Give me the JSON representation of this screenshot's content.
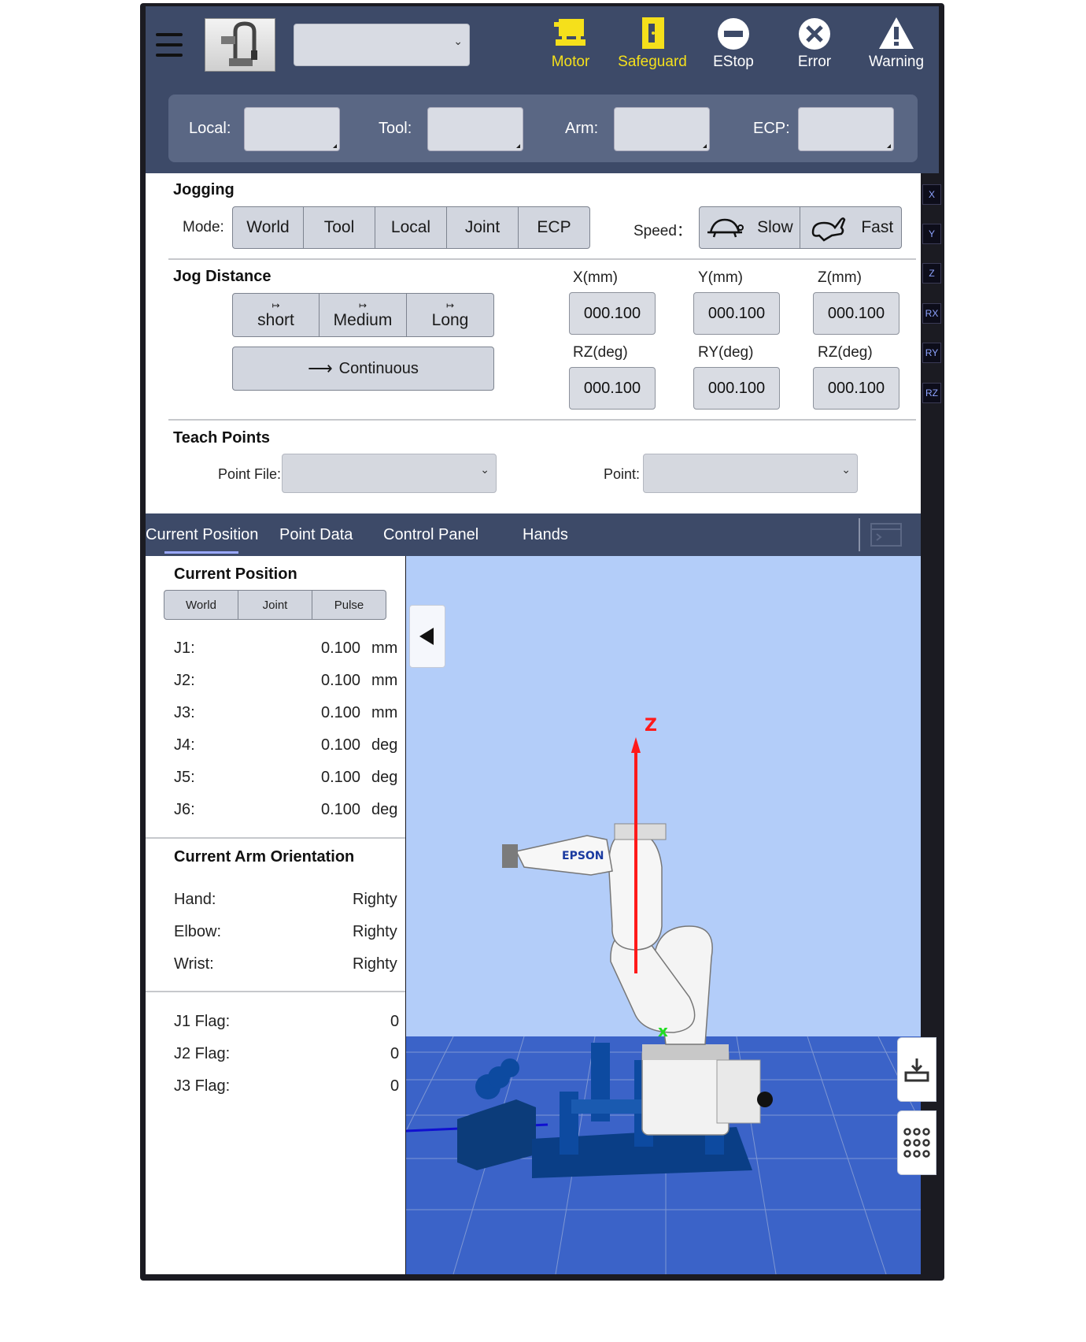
{
  "header": {
    "robot_select": {
      "value": ""
    },
    "status": [
      {
        "label": "Motor",
        "icon": "motor-icon",
        "color": "#f5e01b"
      },
      {
        "label": "Safeguard",
        "icon": "safeguard-icon",
        "color": "#f5e01b"
      },
      {
        "label": "EStop",
        "icon": "estop-icon",
        "color": "#ffffff"
      },
      {
        "label": "Error",
        "icon": "error-icon",
        "color": "#ffffff"
      },
      {
        "label": "Warning",
        "icon": "warning-icon",
        "color": "#ffffff"
      }
    ],
    "coords": {
      "local": {
        "label": "Local:",
        "value": ""
      },
      "tool": {
        "label": "Tool:",
        "value": ""
      },
      "arm": {
        "label": "Arm:",
        "value": ""
      },
      "ecp": {
        "label": "ECP:",
        "value": ""
      }
    }
  },
  "jogging": {
    "title": "Jogging",
    "mode_label": "Mode:",
    "modes": [
      "World",
      "Tool",
      "Local",
      "Joint",
      "ECP"
    ],
    "speed_label": "Speed：",
    "speeds": [
      {
        "label": "Slow",
        "icon": "turtle-icon"
      },
      {
        "label": "Fast",
        "icon": "rabbit-icon"
      }
    ]
  },
  "jog_distance": {
    "title": "Jog Distance",
    "steps": [
      "short",
      "Medium",
      "Long"
    ],
    "continuous": "Continuous",
    "fields": [
      {
        "label": "X(mm)",
        "value": "000.100"
      },
      {
        "label": "Y(mm)",
        "value": "000.100"
      },
      {
        "label": "Z(mm)",
        "value": "000.100"
      },
      {
        "label": "RZ(deg)",
        "value": "000.100"
      },
      {
        "label": "RY(deg)",
        "value": "000.100"
      },
      {
        "label": "RZ(deg)",
        "value": "000.100"
      }
    ]
  },
  "teach_points": {
    "title": "Teach Points",
    "point_file_label": "Point File:",
    "point_label": "Point:"
  },
  "side_axes": [
    "X",
    "Y",
    "Z",
    "RX",
    "RY",
    "RZ"
  ],
  "tabs": [
    "Current Position",
    "Point Data",
    "Control Panel",
    "Hands"
  ],
  "current_position": {
    "title": "Current Position",
    "modes": [
      "World",
      "Joint",
      "Pulse"
    ],
    "joints": [
      {
        "name": "J1:",
        "value": "0.100",
        "unit": "mm"
      },
      {
        "name": "J2:",
        "value": "0.100",
        "unit": "mm"
      },
      {
        "name": "J3:",
        "value": "0.100",
        "unit": "mm"
      },
      {
        "name": "J4:",
        "value": "0.100",
        "unit": "deg"
      },
      {
        "name": "J5:",
        "value": "0.100",
        "unit": "deg"
      },
      {
        "name": "J6:",
        "value": "0.100",
        "unit": "deg"
      }
    ],
    "orientation_title": "Current Arm Orientation",
    "orientation": [
      {
        "name": "Hand:",
        "value": "Righty"
      },
      {
        "name": "Elbow:",
        "value": "Righty"
      },
      {
        "name": "Wrist:",
        "value": "Righty"
      }
    ],
    "flags": [
      {
        "name": "J1 Flag:",
        "value": "0"
      },
      {
        "name": "J2 Flag:",
        "value": "0"
      },
      {
        "name": "J3 Flag:",
        "value": "0"
      }
    ]
  },
  "viewport": {
    "axis_label": "Z",
    "robot_brand": "EPSON"
  }
}
